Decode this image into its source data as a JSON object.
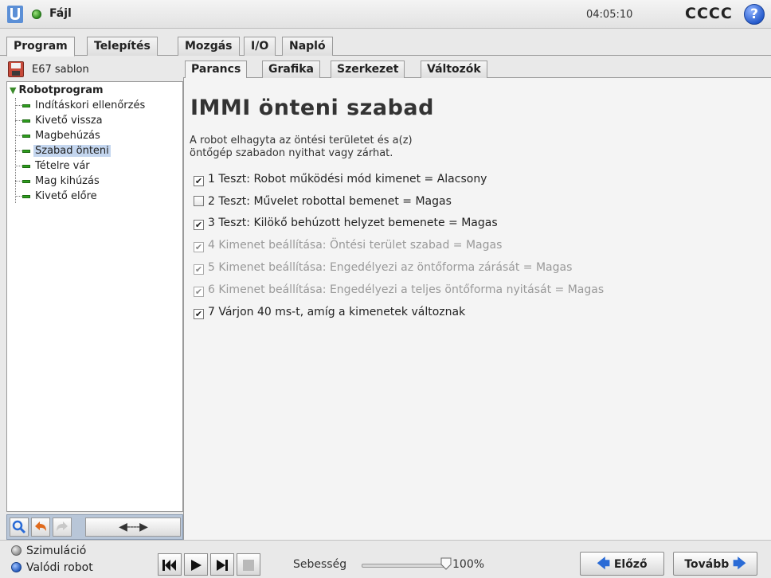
{
  "header": {
    "menu_file": "Fájl",
    "time": "04:05:10",
    "robot_name": "CCCC",
    "help": "?"
  },
  "main_tabs": [
    {
      "label": "Program",
      "active": true
    },
    {
      "label": "Telepítés",
      "active": false
    },
    {
      "label": "Mozgás",
      "active": false
    },
    {
      "label": "I/O",
      "active": false
    },
    {
      "label": "Napló",
      "active": false
    }
  ],
  "program": {
    "name": "E67 sablon",
    "root": "Robotprogram",
    "items": [
      {
        "label": "Indításkori ellenőrzés",
        "selected": false
      },
      {
        "label": "Kivető vissza",
        "selected": false
      },
      {
        "label": "Magbehúzás",
        "selected": false
      },
      {
        "label": "Szabad önteni",
        "selected": true
      },
      {
        "label": "Tételre vár",
        "selected": false
      },
      {
        "label": "Mag kihúzás",
        "selected": false
      },
      {
        "label": "Kivető előre",
        "selected": false
      }
    ]
  },
  "toolbar": {
    "search_icon": "search-icon",
    "undo_icon": "undo-icon",
    "redo_icon": "redo-icon",
    "move_arrow": "◀----▶"
  },
  "sub_tabs": [
    {
      "label": "Parancs",
      "active": true
    },
    {
      "label": "Grafika",
      "active": false
    },
    {
      "label": "Szerkezet",
      "active": false
    },
    {
      "label": "Változók",
      "active": false
    }
  ],
  "command": {
    "title": "IMMI önteni szabad",
    "description_line1": "A robot elhagyta az öntési területet és a(z)",
    "description_line2": "öntőgép szabadon nyithat vagy zárhat.",
    "checks": [
      {
        "text": "1 Teszt: Robot működési mód kimenet = Alacsony",
        "checked": true,
        "disabled": false
      },
      {
        "text": "2 Teszt: Művelet robottal bemenet = Magas",
        "checked": false,
        "disabled": false
      },
      {
        "text": "3 Teszt: Kilökő behúzott helyzet bemenete = Magas",
        "checked": true,
        "disabled": false
      },
      {
        "text": "4 Kimenet beállítása: Öntési terület szabad = Magas",
        "checked": true,
        "disabled": true
      },
      {
        "text": "5 Kimenet beállítása: Engedélyezi az öntőforma zárását = Magas",
        "checked": true,
        "disabled": true
      },
      {
        "text": "6 Kimenet beállítása: Engedélyezi a teljes öntőforma nyitását = Magas",
        "checked": true,
        "disabled": true
      },
      {
        "text": "7 Várjon 40 ms-t, amíg a kimenetek változnak",
        "checked": true,
        "disabled": false
      }
    ]
  },
  "bottom": {
    "mode_simulation": "Szimuláció",
    "mode_real": "Valódi robot",
    "speed_label": "Sebesség",
    "speed_value": "100%",
    "speed_fraction": 1.0,
    "prev_label": "Előző",
    "next_label": "Tovább"
  },
  "colors": {
    "accent_blue": "#2a6bd6",
    "tree_mark_green": "#2e9e1e",
    "selection": "#c4d6ef"
  }
}
